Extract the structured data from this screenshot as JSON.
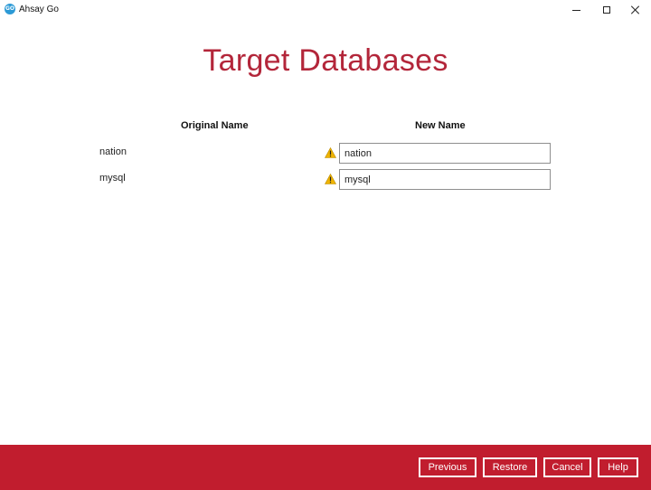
{
  "window": {
    "app_title": "Ahsay Go",
    "logo_text": "GO",
    "controls": [
      "minimize",
      "maximize",
      "close"
    ]
  },
  "page": {
    "title": "Target Databases"
  },
  "table": {
    "headers": {
      "original": "Original Name",
      "new": "New Name"
    },
    "rows": [
      {
        "original": "nation",
        "new_value": "nation",
        "icon": "warning-icon"
      },
      {
        "original": "mysql",
        "new_value": "mysql",
        "icon": "warning-icon"
      }
    ]
  },
  "footer": {
    "previous_label": "Previous",
    "restore_label": "Restore",
    "cancel_label": "Cancel",
    "help_label": "Help"
  },
  "colors": {
    "accent": "#b3263a",
    "footer_bg": "#c11d2e",
    "warning": "#f0b400"
  }
}
